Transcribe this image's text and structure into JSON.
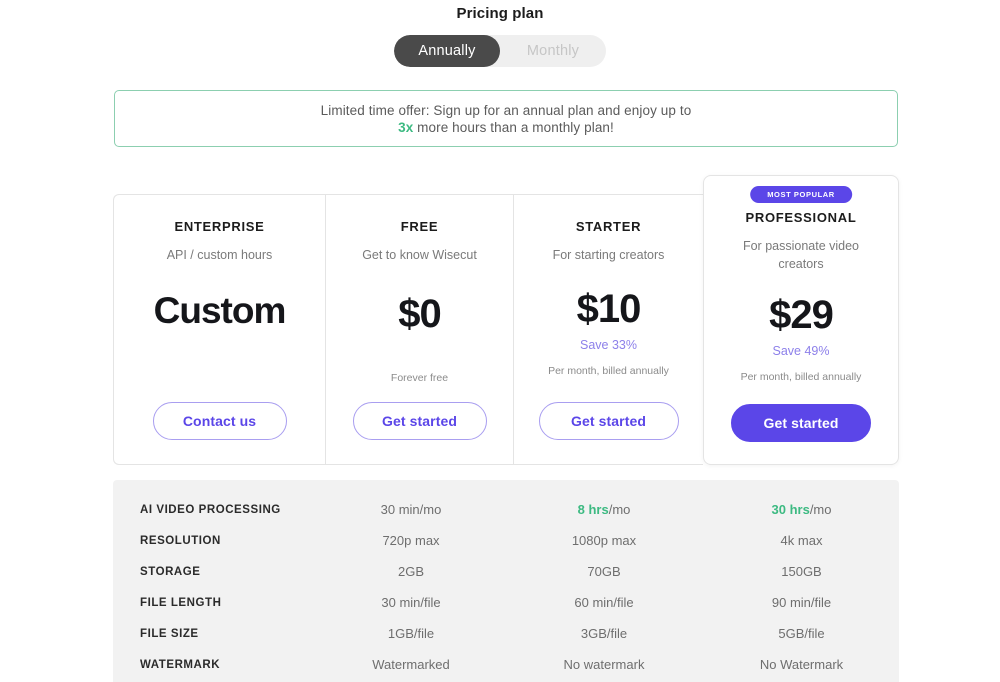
{
  "header": {
    "title": "Pricing plan",
    "billing_toggle": {
      "options": [
        {
          "label": "Annually",
          "active": true
        },
        {
          "label": "Monthly",
          "active": false
        }
      ]
    }
  },
  "promo_banner": {
    "line1": "Limited time offer: Sign up for an annual plan and enjoy up to",
    "accent": "3x",
    "line2_rest": " more hours than a monthly plan!",
    "border_color": "#8ccfb0",
    "accent_color": "#3dba82"
  },
  "plans": [
    {
      "name": "ENTERPRISE",
      "tagline": "API / custom hours",
      "price": "Custom",
      "save": "",
      "note": "",
      "cta": "Contact us",
      "badge": "",
      "highlight": false
    },
    {
      "name": "FREE",
      "tagline": "Get to know Wisecut",
      "price": "$0",
      "save": "",
      "note": "Forever free",
      "cta": "Get started",
      "badge": "",
      "highlight": false
    },
    {
      "name": "STARTER",
      "tagline": "For starting creators",
      "price": "$10",
      "save": "Save 33%",
      "note": "Per month, billed annually",
      "cta": "Get started",
      "badge": "",
      "highlight": false
    },
    {
      "name": "PROFESSIONAL",
      "tagline": "For passionate video creators",
      "price": "$29",
      "save": "Save 49%",
      "note": "Per month, billed annually",
      "cta": "Get started",
      "badge": "MOST POPULAR",
      "highlight": true
    }
  ],
  "comparison": {
    "rows": [
      {
        "feature": "AI VIDEO PROCESSING",
        "free": "30 min/mo",
        "starter_hl": "8 hrs",
        "starter_rest": "/mo",
        "pro_hl": "30 hrs",
        "pro_rest": "/mo"
      },
      {
        "feature": "RESOLUTION",
        "free": "720p max",
        "starter": "1080p max",
        "pro": "4k max"
      },
      {
        "feature": "STORAGE",
        "free": "2GB",
        "starter": "70GB",
        "pro": "150GB"
      },
      {
        "feature": "FILE LENGTH",
        "free": "30 min/file",
        "starter": "60 min/file",
        "pro": "90 min/file"
      },
      {
        "feature": "FILE SIZE",
        "free": "1GB/file",
        "starter": "3GB/file",
        "pro": "5GB/file"
      },
      {
        "feature": "WATERMARK",
        "free": "Watermarked",
        "starter": "No watermark",
        "pro": "No Watermark"
      }
    ]
  },
  "colors": {
    "brand_purple": "#5b46e8",
    "save_purple": "#8d80ea",
    "accent_green": "#3dba82",
    "toggle_active_bg": "#4a4a4a",
    "table_bg": "#f2f2f2"
  }
}
